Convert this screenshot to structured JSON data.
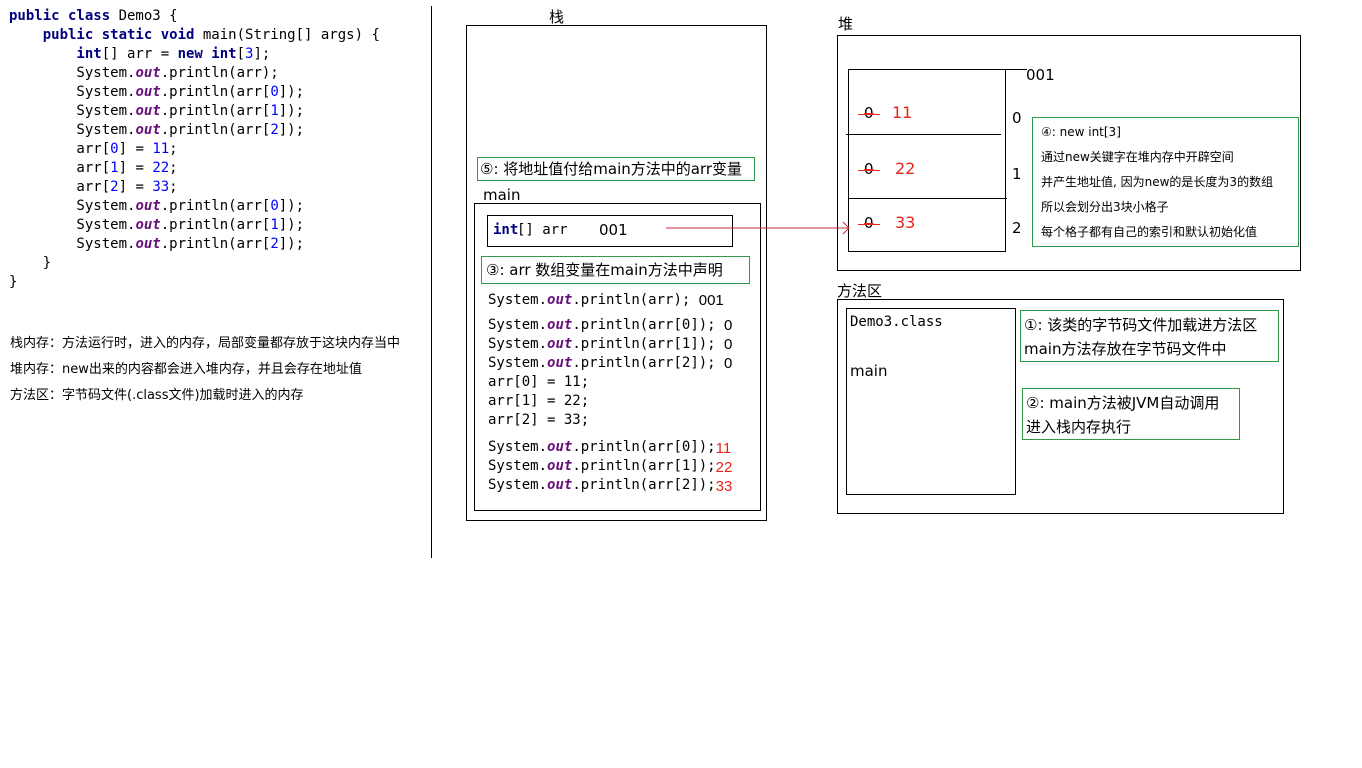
{
  "code": {
    "lines": [
      [
        {
          "t": "public class ",
          "c": "kw"
        },
        {
          "t": "Demo3 {",
          "c": ""
        }
      ],
      [
        {
          "t": "    public static void ",
          "c": "kw"
        },
        {
          "t": "main(String[] args) {",
          "c": ""
        }
      ],
      [
        {
          "t": "        int",
          "c": "kw"
        },
        {
          "t": "[] arr = ",
          "c": ""
        },
        {
          "t": "new int",
          "c": "kw"
        },
        {
          "t": "[",
          "c": ""
        },
        {
          "t": "3",
          "c": "num"
        },
        {
          "t": "];",
          "c": ""
        }
      ],
      [
        {
          "t": "        System.",
          "c": ""
        },
        {
          "t": "out",
          "c": "fld"
        },
        {
          "t": ".println(arr);",
          "c": ""
        }
      ],
      [
        {
          "t": "        System.",
          "c": ""
        },
        {
          "t": "out",
          "c": "fld"
        },
        {
          "t": ".println(arr[",
          "c": ""
        },
        {
          "t": "0",
          "c": "num"
        },
        {
          "t": "]);",
          "c": ""
        }
      ],
      [
        {
          "t": "        System.",
          "c": ""
        },
        {
          "t": "out",
          "c": "fld"
        },
        {
          "t": ".println(arr[",
          "c": ""
        },
        {
          "t": "1",
          "c": "num"
        },
        {
          "t": "]);",
          "c": ""
        }
      ],
      [
        {
          "t": "        System.",
          "c": ""
        },
        {
          "t": "out",
          "c": "fld"
        },
        {
          "t": ".println(arr[",
          "c": ""
        },
        {
          "t": "2",
          "c": "num"
        },
        {
          "t": "]);",
          "c": ""
        }
      ],
      [
        {
          "t": "        arr[",
          "c": ""
        },
        {
          "t": "0",
          "c": "num"
        },
        {
          "t": "] = ",
          "c": ""
        },
        {
          "t": "11",
          "c": "num"
        },
        {
          "t": ";",
          "c": ""
        }
      ],
      [
        {
          "t": "        arr[",
          "c": ""
        },
        {
          "t": "1",
          "c": "num"
        },
        {
          "t": "] = ",
          "c": ""
        },
        {
          "t": "22",
          "c": "num"
        },
        {
          "t": ";",
          "c": ""
        }
      ],
      [
        {
          "t": "        arr[",
          "c": ""
        },
        {
          "t": "2",
          "c": "num"
        },
        {
          "t": "] = ",
          "c": ""
        },
        {
          "t": "33",
          "c": "num"
        },
        {
          "t": ";",
          "c": ""
        }
      ],
      [
        {
          "t": "        System.",
          "c": ""
        },
        {
          "t": "out",
          "c": "fld"
        },
        {
          "t": ".println(arr[",
          "c": ""
        },
        {
          "t": "0",
          "c": "num"
        },
        {
          "t": "]);",
          "c": ""
        }
      ],
      [
        {
          "t": "        System.",
          "c": ""
        },
        {
          "t": "out",
          "c": "fld"
        },
        {
          "t": ".println(arr[",
          "c": ""
        },
        {
          "t": "1",
          "c": "num"
        },
        {
          "t": "]);",
          "c": ""
        }
      ],
      [
        {
          "t": "        System.",
          "c": ""
        },
        {
          "t": "out",
          "c": "fld"
        },
        {
          "t": ".println(arr[",
          "c": ""
        },
        {
          "t": "2",
          "c": "num"
        },
        {
          "t": "]);",
          "c": ""
        }
      ],
      [
        {
          "t": "    }",
          "c": ""
        }
      ],
      [
        {
          "t": "}",
          "c": ""
        }
      ]
    ]
  },
  "notes": {
    "stack": "栈内存：方法运行时，进入的内存，局部变量都存放于这块内存当中",
    "heap": "堆内存：new出来的内容都会进入堆内存，并且会存在地址值",
    "method_area": "方法区：字节码文件(.class文件)加载时进入的内存"
  },
  "stack": {
    "title": "栈",
    "note5": "⑤: 将地址值付给main方法中的arr变量",
    "frame_label": "main",
    "var_type": "int",
    "var_rest": "[] arr",
    "var_value": "001",
    "note3": "③: arr 数组变量在main方法中声明",
    "lines": [
      {
        "prefix": "System.",
        "out": "out",
        "suffix": ".println(arr); ",
        "result": "001",
        "result_red": false
      },
      {
        "prefix": "System.",
        "out": "out",
        "suffix": ".println(arr[0]); ",
        "result": "0",
        "result_red": false
      },
      {
        "prefix": "System.",
        "out": "out",
        "suffix": ".println(arr[1]); ",
        "result": "0",
        "result_red": false
      },
      {
        "prefix": "System.",
        "out": "out",
        "suffix": ".println(arr[2]); ",
        "result": "0",
        "result_red": false
      }
    ],
    "assigns": [
      "arr[0] = 11;",
      "arr[1] = 22;",
      "arr[2] = 33;"
    ],
    "lines2": [
      {
        "prefix": "System.",
        "out": "out",
        "suffix": ".println(arr[0]);",
        "result": "11",
        "result_red": true
      },
      {
        "prefix": "System.",
        "out": "out",
        "suffix": ".println(arr[1]);",
        "result": "22",
        "result_red": true
      },
      {
        "prefix": "System.",
        "out": "out",
        "suffix": ".println(arr[2]);",
        "result": "33",
        "result_red": true
      }
    ]
  },
  "heap": {
    "title": "堆",
    "address": "001",
    "cells": [
      {
        "old": "0",
        "value": "11",
        "index": "0"
      },
      {
        "old": "0",
        "value": "22",
        "index": "1"
      },
      {
        "old": "0",
        "value": "33",
        "index": "2"
      }
    ],
    "note4": [
      "④: new int[3]",
      "通过new关键字在堆内存中开辟空间",
      "并产生地址值, 因为new的是长度为3的数组",
      "所以会划分出3块小格子",
      "每个格子都有自己的索引和默认初始化值"
    ]
  },
  "method_area": {
    "title": "方法区",
    "class_name": "Demo3.class",
    "method": "main",
    "note1": [
      "①: 该类的字节码文件加载进方法区",
      "main方法存放在字节码文件中"
    ],
    "note2": [
      "②: main方法被JVM自动调用",
      "进入栈内存执行"
    ]
  },
  "colors": {
    "keyword": "#000080",
    "field": "#660e7a",
    "number": "#0000ff",
    "value_red": "#e2261b",
    "note_border": "#2e9a4a",
    "arrow": "#c8283a"
  }
}
